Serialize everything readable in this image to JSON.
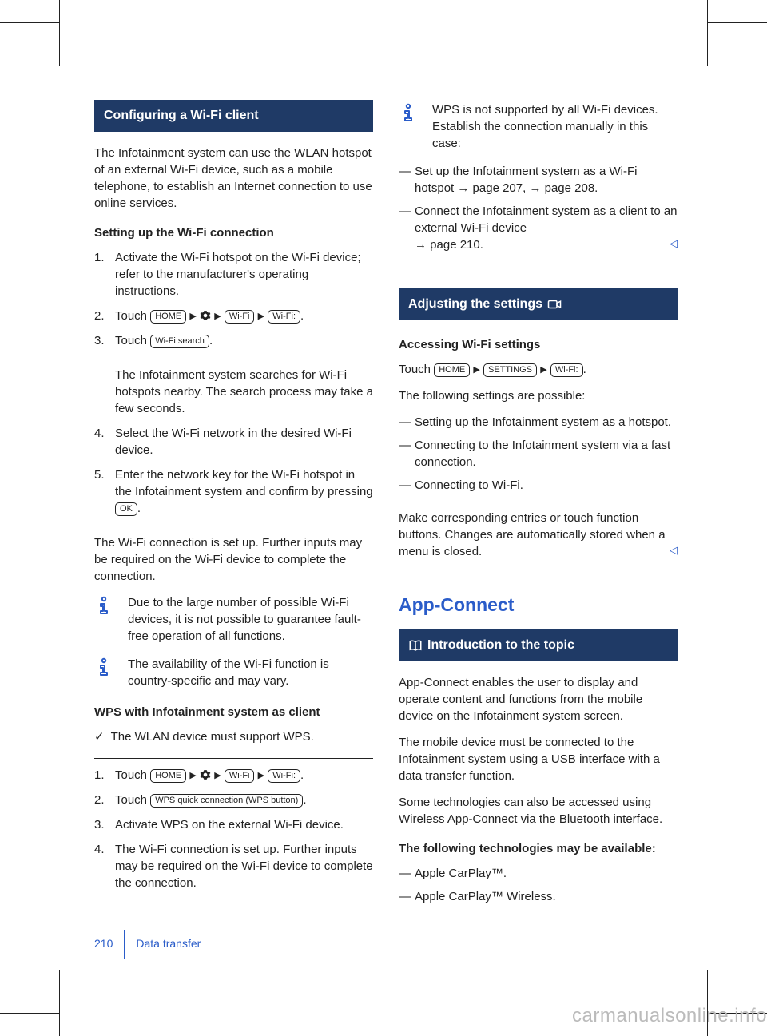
{
  "left": {
    "h1": "Configuring a Wi-Fi client",
    "intro": "The Infotainment system can use the WLAN hotspot of an external Wi-Fi device, such as a mobile telephone, to establish an Internet connection to use online services.",
    "sub1": "Setting up the Wi-Fi connection",
    "steps1": {
      "s1": "Activate the Wi-Fi hotspot on the Wi-Fi device; refer to the manufacturer's operating instructions.",
      "s2a": "Touch ",
      "s2_home": "HOME",
      "s2_wifi": "Wi-Fi",
      "s2_wifi2": "Wi-Fi:",
      "s3a": "Touch ",
      "s3_btn": "Wi-Fi search",
      "s3_body": "The Infotainment system searches for Wi-Fi hotspots nearby. The search process may take a few seconds.",
      "s4": "Select the Wi-Fi network in the desired Wi-Fi device.",
      "s5a": "Enter the network key for the Wi-Fi hotspot in the Infotainment system and confirm by pressing ",
      "s5_ok": "OK"
    },
    "para2": "The Wi-Fi connection is set up. Further inputs may be required on the Wi-Fi device to complete the connection.",
    "note1": "Due to the large number of possible Wi-Fi devices, it is not possible to guarantee fault-free operation of all functions.",
    "note2": "The availability of the Wi-Fi function is country-specific and may vary.",
    "sub2": "WPS with Infotainment system as client",
    "check": "The WLAN device must support WPS.",
    "steps2": {
      "s1a": "Touch ",
      "s1_home": "HOME",
      "s1_wifi": "Wi-Fi",
      "s1_wifi2": "Wi-Fi:",
      "s2a": "Touch ",
      "s2_btn": "WPS quick connection (WPS button)",
      "s3": "Activate WPS on the external Wi-Fi device.",
      "s4": "The Wi-Fi connection is set up. Further inputs may be required on the Wi-Fi device to complete the connection."
    }
  },
  "right": {
    "note3a": "WPS is not supported by all Wi-Fi devices. Establish the connection manually in this case:",
    "dash1": {
      "d1a": "Set up the Infotainment system as a Wi-Fi hotspot ",
      "d1b": " page 207, ",
      "d1c": " page 208.",
      "d2a": "Connect the Infotainment system as a client to an external Wi-Fi device ",
      "d2b": " page 210."
    },
    "h2": "Adjusting the settings ",
    "sub3": "Accessing Wi-Fi settings",
    "acc_a": "Touch ",
    "acc_home": "HOME",
    "acc_settings": "SETTINGS",
    "acc_wifi": "Wi-Fi:",
    "para3": "The following settings are possible:",
    "dash2": {
      "d1": "Setting up the Infotainment system as a hotspot.",
      "d2": "Connecting to the Infotainment system via a fast connection.",
      "d3": "Connecting to Wi-Fi."
    },
    "para4": "Make corresponding entries or touch function buttons. Changes are automatically stored when a menu is closed.",
    "section": "App-Connect",
    "h3": "Introduction to the topic",
    "para5": "App-Connect enables the user to display and operate content and functions from the mobile device on the Infotainment system screen.",
    "para6": "The mobile device must be connected to the Infotainment system using a USB interface with a data transfer function.",
    "para7": "Some technologies can also be accessed using Wireless App-Connect via the Bluetooth interface.",
    "sub4": "The following technologies may be available:",
    "dash3": {
      "d1": "Apple CarPlay™.",
      "d2": "Apple CarPlay™ Wireless."
    }
  },
  "footer": {
    "page": "210",
    "chapter": "Data transfer"
  },
  "watermark": "carmanualsonline.info"
}
